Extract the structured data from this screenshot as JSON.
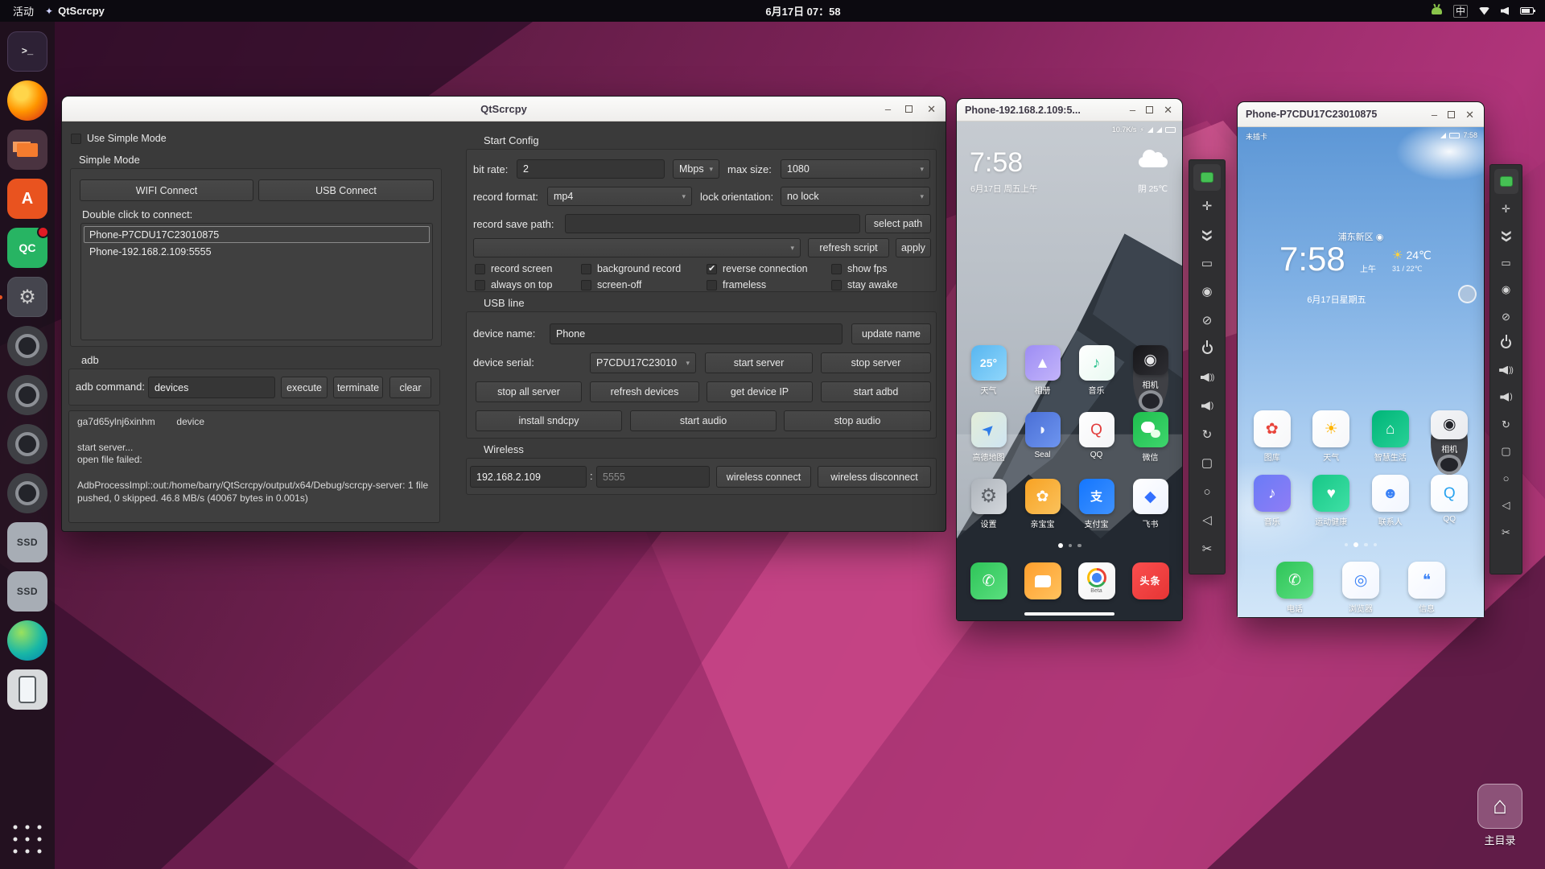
{
  "colors": {
    "accent": "#e95420",
    "titlebar": "#f6f5f4",
    "window_bg": "#3a3a3a",
    "indicator_green": "#46c054"
  },
  "topbar": {
    "activities": "活动",
    "app": "QtScrcpy",
    "clock": "6月17日 07：58",
    "ime": "中"
  },
  "dock": {
    "items": [
      {
        "name": "terminal",
        "glyph": ">_"
      },
      {
        "name": "firefox"
      },
      {
        "name": "files"
      },
      {
        "name": "software",
        "glyph": "A"
      },
      {
        "name": "qc",
        "glyph": "QC",
        "badge": true
      },
      {
        "name": "settings",
        "glyph": "⚙",
        "active": true
      },
      {
        "name": "camera-1"
      },
      {
        "name": "camera-2"
      },
      {
        "name": "camera-3"
      },
      {
        "name": "camera-4"
      },
      {
        "name": "ssd-1",
        "glyph": "SSD"
      },
      {
        "name": "ssd-2",
        "glyph": "SSD"
      },
      {
        "name": "globe"
      },
      {
        "name": "smartphone"
      }
    ]
  },
  "desktop": {
    "home_label": "主目录"
  },
  "main_window": {
    "title": "QtScrcpy",
    "left": {
      "use_simple_mode_label": "Use Simple Mode",
      "group_title": "Simple Mode",
      "wifi_btn": "WIFI Connect",
      "usb_btn": "USB Connect",
      "list_hint": "Double click to connect:",
      "devices": [
        {
          "label": "Phone-P7CDU17C23010875",
          "sel": true
        },
        {
          "label": "Phone-192.168.2.109:5555"
        }
      ],
      "adb_title": "adb",
      "adb_cmd_label": "adb command:",
      "adb_cmd_value": "devices",
      "execute_btn": "execute",
      "terminate_btn": "terminate",
      "clear_btn": "clear",
      "output": "ga7d65ylnj6xinhm        device\n\nstart server...\nopen file failed:\n\nAdbProcessImpl::out:/home/barry/QtScrcpy/output/x64/Debug/scrcpy-server: 1 file pushed, 0 skipped. 46.8 MB/s (40067 bytes in 0.001s)"
    },
    "start_config": {
      "title": "Start Config",
      "bit_rate_label": "bit rate:",
      "bit_rate_value": "2",
      "bit_rate_unit": "Mbps",
      "max_size_label": "max size:",
      "max_size_value": "1080",
      "record_format_label": "record format:",
      "record_format_value": "mp4",
      "lock_orientation_label": "lock orientation:",
      "lock_orientation_value": "no lock",
      "record_save_path_label": "record save path:",
      "record_save_path_value": "",
      "select_path_btn": "select path",
      "refresh_script_btn": "refresh script",
      "apply_btn": "apply",
      "checks_row1": [
        {
          "label": "record screen"
        },
        {
          "label": "background record"
        },
        {
          "label": "reverse connection",
          "checked": true
        },
        {
          "label": "show fps"
        }
      ],
      "checks_row2": [
        {
          "label": "always on top"
        },
        {
          "label": "screen-off"
        },
        {
          "label": "frameless"
        },
        {
          "label": "stay awake"
        }
      ]
    },
    "usb_line": {
      "title": "USB line",
      "device_name_label": "device name:",
      "device_name_value": "Phone",
      "update_name_btn": "update name",
      "device_serial_label": "device serial:",
      "device_serial_value": "P7CDU17C23010",
      "start_server_btn": "start server",
      "stop_server_btn": "stop server",
      "stop_all_server_btn": "stop all server",
      "refresh_devices_btn": "refresh devices",
      "get_device_ip_btn": "get device IP",
      "start_adbd_btn": "start adbd",
      "install_sndcpy_btn": "install sndcpy",
      "start_audio_btn": "start audio",
      "stop_audio_btn": "stop audio"
    },
    "wireless": {
      "title": "Wireless",
      "ip_value": "192.168.2.109",
      "separator": ":",
      "port_placeholder": "5555",
      "connect_btn": "wireless connect",
      "disconnect_btn": "wireless disconnect"
    }
  },
  "phone1": {
    "title": "Phone-192.168.2.109:5...",
    "status_right": "10.7K/s",
    "status_bolt": "⚡",
    "clock": "7:58",
    "date": "6月17日 周五上午",
    "weather": "阴 25℃",
    "apps": [
      {
        "label": "天气",
        "icon": "weather",
        "glyph": "25°",
        "c1": "#58b6f0",
        "c2": "#8fd6fb",
        "fg": "#ffffff"
      },
      {
        "label": "相册",
        "icon": "gallery",
        "glyph": "▲",
        "c1": "#9d8df4",
        "c2": "#c3b4fa",
        "fg": "#ffffff"
      },
      {
        "label": "音乐",
        "icon": "music",
        "glyph": "♪",
        "c1": "#ffffff",
        "c2": "#e9f9f1",
        "fg": "#27c08d"
      },
      {
        "label": "相机",
        "icon": "camera",
        "glyph": "◉",
        "c1": "#17171a",
        "c2": "#2e2e33",
        "fg": "#e8e8ea"
      },
      {
        "label": "高德地图",
        "icon": "maps",
        "glyph": "➤",
        "c1": "#e4eed8",
        "c2": "#cfe5f2",
        "fg": "#2f7ce8"
      },
      {
        "label": "Seal",
        "icon": "seal",
        "glyph": "◗",
        "c1": "#4a6fd6",
        "c2": "#6e95ef",
        "fg": "#f4f7ff"
      },
      {
        "label": "QQ",
        "icon": "qq",
        "glyph": "Q",
        "c1": "#ffffff",
        "c2": "#f3f4f6",
        "fg": "#e23c3c"
      },
      {
        "label": "微信",
        "icon": "wechat",
        "glyph": "",
        "c1": "#1fbe4e",
        "c2": "#3ed66d",
        "fg": "#ffffff"
      },
      {
        "label": "设置",
        "icon": "settings2",
        "glyph": "⚙",
        "c1": "#aeb4bb",
        "c2": "#d3d7dc",
        "fg": "#5c6066"
      },
      {
        "label": "亲宝宝",
        "icon": "baby",
        "glyph": "✿",
        "c1": "#f7a223",
        "c2": "#fbc25c",
        "fg": "#ffffff"
      },
      {
        "label": "支付宝",
        "icon": "alipay",
        "glyph": "支",
        "c1": "#1476fe",
        "c2": "#3f92ff",
        "fg": "#ffffff"
      },
      {
        "label": "飞书",
        "icon": "feishu",
        "glyph": "◆",
        "c1": "#ffffff",
        "c2": "#eef3ff",
        "fg": "#3370ff"
      }
    ],
    "dots": [
      {
        "state": "active"
      },
      {
        "state": "dim"
      },
      {
        "state": "dim"
      }
    ],
    "dock": [
      {
        "name": "phone",
        "icon": "phone",
        "glyph": "✆",
        "c1": "#2fc459",
        "c2": "#5adf7f",
        "fg": "#ffffff"
      },
      {
        "name": "messages",
        "icon": "sms",
        "glyph": "",
        "c1": "#ff9f2d",
        "c2": "#ffc25e",
        "fg": "#ffffff"
      },
      {
        "name": "chrome",
        "icon": "chrome",
        "glyph": "",
        "sub": "Beta",
        "c1": "#ffffff",
        "c2": "#f2f2f2",
        "fg": "#4285f4"
      },
      {
        "name": "toutiao",
        "icon": "toutiao",
        "glyph": "头条",
        "c1": "#fb4e4e",
        "c2": "#e63535",
        "fg": "#ffffff"
      }
    ]
  },
  "phone2": {
    "title": "Phone-P7CDU17C23010875",
    "status_left": "未插卡",
    "status_time": "7:58",
    "location": "浦东新区 ◉",
    "clock": "7:58",
    "ampm": "上午",
    "temp": "24℃",
    "sun": "☀",
    "hilo": "31 / 22℃",
    "date": "6月17日星期五",
    "apps": [
      {
        "label": "图库",
        "icon": "gallery2",
        "glyph": "✿",
        "c1": "#ffffff",
        "c2": "#f6f7f9",
        "fg": "#e8453c"
      },
      {
        "label": "天气",
        "icon": "weather2",
        "glyph": "☀",
        "c1": "#ffffff",
        "c2": "#f6f7f9",
        "fg": "#ffb400"
      },
      {
        "label": "智慧生活",
        "icon": "smartlife",
        "gl yph": "⌂",
        "glyph": "⌂",
        "c1": "#00b578",
        "c2": "#27d196",
        "fg": "#ffffff"
      },
      {
        "label": "相机",
        "icon": "camera2",
        "glyph": "◉",
        "c1": "#f4f5f7",
        "c2": "#e9eaee",
        "fg": "#23242a"
      },
      {
        "label": "音乐",
        "icon": "music2",
        "glyph": "♪",
        "c1": "#6a7bf7",
        "c2": "#8f7df5",
        "fg": "#ffffff"
      },
      {
        "label": "运动健康",
        "icon": "health",
        "glyph": "♥",
        "c1": "#17c787",
        "c2": "#3fe0a5",
        "fg": "#ffffff"
      },
      {
        "label": "联系人",
        "icon": "contacts",
        "glyph": "☻",
        "c1": "#ffffff",
        "c2": "#f2f6ff",
        "fg": "#3b82f6"
      },
      {
        "label": "QQ",
        "icon": "qq2",
        "glyph": "Q",
        "c1": "#ffffff",
        "c2": "#f4f9ff",
        "fg": "#29a3ef"
      }
    ],
    "dots": [
      {
        "state": "dim"
      },
      {
        "state": "active"
      },
      {
        "state": "dim"
      },
      {
        "state": "dim"
      }
    ],
    "dock": [
      {
        "label": "电话",
        "icon": "phone",
        "glyph": "✆",
        "c1": "#2fc459",
        "c2": "#5adf7f",
        "fg": "#ffffff"
      },
      {
        "label": "浏览器",
        "icon": "browser",
        "glyph": "◎",
        "c1": "#ffffff",
        "c2": "#f2f6ff",
        "fg": "#3b82f6"
      },
      {
        "label": "信息",
        "icon": "messages2",
        "glyph": "❝",
        "c1": "#ffffff",
        "c2": "#f2f6ff",
        "fg": "#3b82f6"
      }
    ]
  },
  "toolbar": {
    "items": [
      {
        "name": "state-indicator",
        "type": "green"
      },
      {
        "name": "fullscreen",
        "glyph": "✛"
      },
      {
        "name": "collapse",
        "glyph": "❯❯",
        "type": "rot"
      },
      {
        "name": "touch-display",
        "glyph": "▭"
      },
      {
        "name": "screen-on",
        "glyph": "◉"
      },
      {
        "name": "screen-off",
        "glyph": "⊘"
      },
      {
        "name": "power",
        "type": "power"
      },
      {
        "name": "volume-up",
        "type": "spk",
        "waves": "))"
      },
      {
        "name": "volume-down",
        "type": "spk",
        "waves": ")"
      },
      {
        "name": "rotate",
        "glyph": "↻"
      },
      {
        "name": "app-switch",
        "glyph": "▢"
      },
      {
        "name": "home",
        "glyph": "○"
      },
      {
        "name": "back",
        "glyph": "◁"
      },
      {
        "name": "scissors",
        "glyph": "✂"
      }
    ]
  }
}
